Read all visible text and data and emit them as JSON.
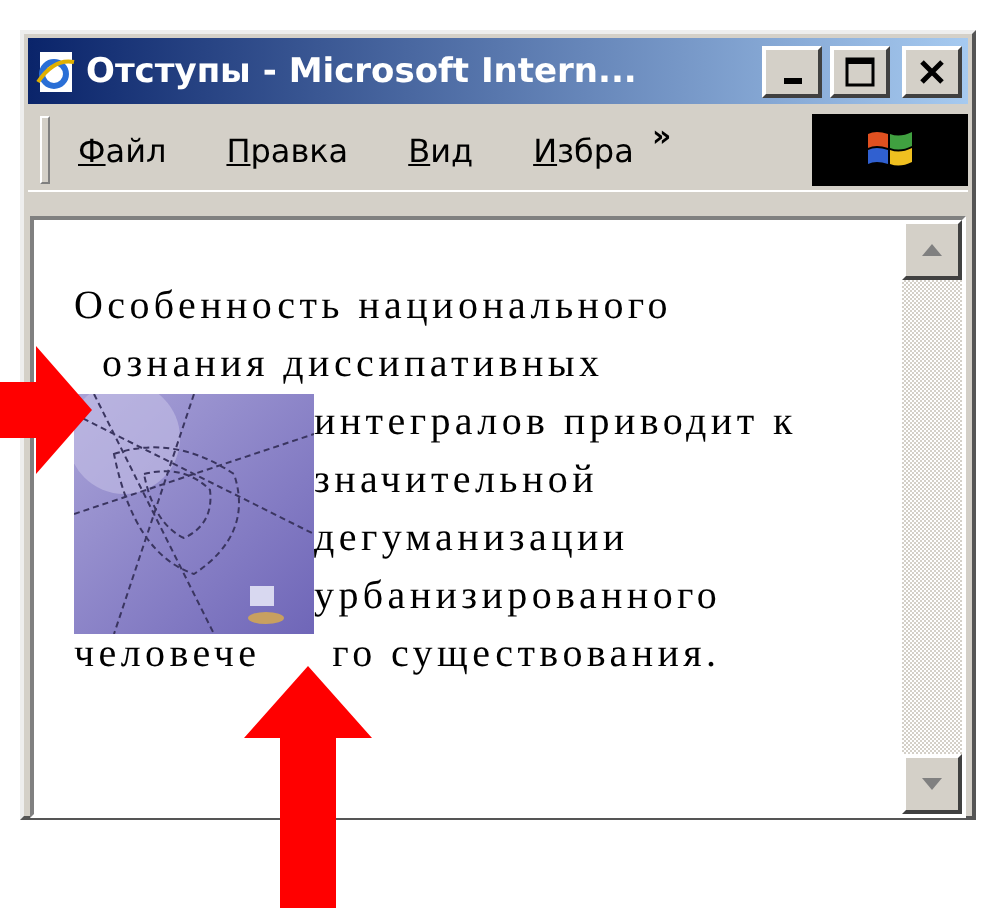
{
  "window": {
    "title": "Отступы - Microsoft Intern..."
  },
  "menu": [
    {
      "label": "Файл"
    },
    {
      "label": "Правка"
    },
    {
      "label": "Вид"
    },
    {
      "label": "Избра"
    }
  ],
  "menu_overflow": "»",
  "paragraph": {
    "lines": [
      "Особенность национального",
      "ознания диссипативных",
      "интегралов приводит к",
      "значительной",
      "дегуманизации",
      "урбанизированного"
    ],
    "last_line": [
      "человече",
      "го существования."
    ]
  }
}
